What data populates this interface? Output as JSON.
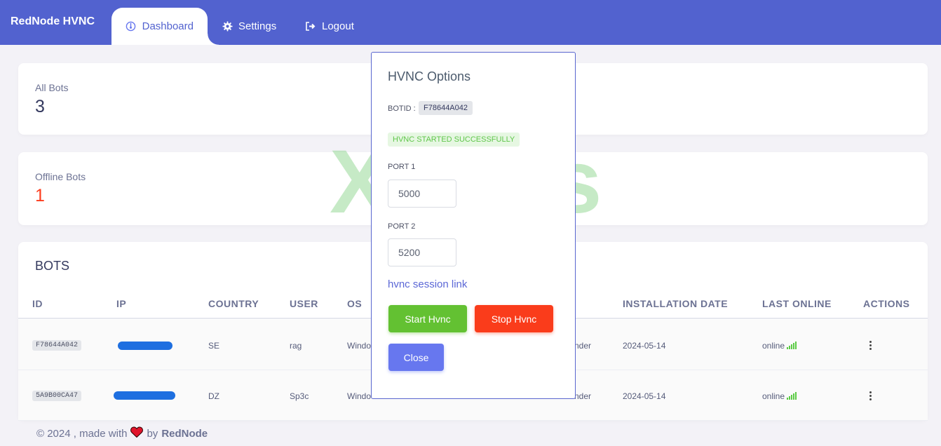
{
  "nav": {
    "brand": "RedNode HVNC",
    "dashboard": "Dashboard",
    "settings": "Settings",
    "logout": "Logout",
    "active_tab": "Dashboard"
  },
  "stats": {
    "all_bots_label": "All Bots",
    "all_bots_value": "3",
    "offline_label": "Offline Bots",
    "offline_value": "1"
  },
  "bots": {
    "title": "BOTS",
    "columns": [
      "ID",
      "IP",
      "COUNTRY",
      "USER",
      "OS",
      "INSTALLATION DATE",
      "LAST ONLINE",
      "ACTIONS"
    ],
    "rows": [
      {
        "id": "F78644A042",
        "country": "SE",
        "user": "rag",
        "os": "Windo",
        "av": "nder",
        "install_date": "2024-05-14",
        "last_online": "online"
      },
      {
        "id": "5A9B00CA47",
        "country": "DZ",
        "user": "Sp3c",
        "os": "Windo",
        "av": "nder",
        "install_date": "2024-05-14",
        "last_online": "online"
      }
    ]
  },
  "modal": {
    "title": "HVNC Options",
    "botid_label": "BOTID :",
    "botid_value": "F78644A042",
    "status": "HVNC STARTED SUCCESSFULLY",
    "port1_label": "PORT 1",
    "port1_value": "5000",
    "port2_label": "PORT 2",
    "port2_value": "5200",
    "session_link": "hvnc session link",
    "start_button": "Start Hvnc",
    "stop_button": "Stop Hvnc",
    "close_button": "Close"
  },
  "footer": {
    "text": "© 2024 , made with",
    "by": "by",
    "author": "RedNode"
  },
  "watermark": "XSS.is",
  "colors": {
    "navbar": "#5262cf",
    "accent": "#6777ef",
    "success": "#63c132",
    "danger": "#fa3c1b",
    "offline_value": "#fc3c1d",
    "online_signal": "#5ccb45"
  }
}
